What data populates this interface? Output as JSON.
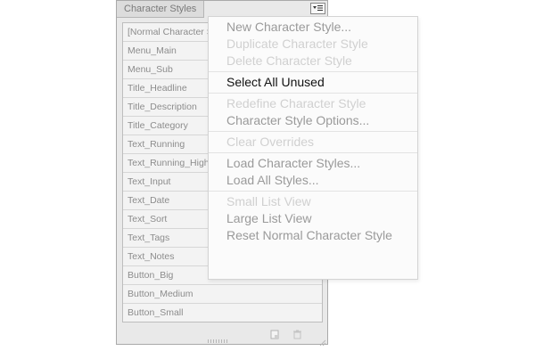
{
  "panel": {
    "title": "Character Styles",
    "menu_button_icon": "panel-menu-icon",
    "styles": [
      "[Normal Character Style]",
      "Menu_Main",
      "Menu_Sub",
      "Title_Headline",
      "Title_Description",
      "Title_Category",
      "Text_Running",
      "Text_Running_Highlight",
      "Text_Input",
      "Text_Date",
      "Text_Sort",
      "Text_Tags",
      "Text_Notes",
      "Button_Big",
      "Button_Medium",
      "Button_Small"
    ],
    "footer": {
      "new_style_icon": "new-style-icon",
      "delete_style_icon": "trash-icon"
    }
  },
  "flyout_menu": {
    "groups": [
      [
        {
          "label": "New Character Style...",
          "state": "enabled"
        },
        {
          "label": "Duplicate Character Style",
          "state": "disabled"
        },
        {
          "label": "Delete Character Style",
          "state": "disabled"
        }
      ],
      [
        {
          "label": "Select All Unused",
          "state": "highlighted"
        }
      ],
      [
        {
          "label": "Redefine Character Style",
          "state": "disabled"
        },
        {
          "label": "Character Style Options...",
          "state": "enabled"
        }
      ],
      [
        {
          "label": "Clear Overrides",
          "state": "disabled"
        }
      ],
      [
        {
          "label": "Load Character Styles...",
          "state": "enabled"
        },
        {
          "label": "Load All Styles...",
          "state": "enabled"
        }
      ],
      [
        {
          "label": "Small List View",
          "state": "disabled"
        },
        {
          "label": "Large List View",
          "state": "enabled"
        },
        {
          "label": "Reset Normal Character Style",
          "state": "enabled"
        }
      ]
    ]
  },
  "colors": {
    "panel_bg": "#e9e9e9",
    "menu_text_enabled": "#9a9a9a",
    "menu_text_disabled": "#d0d0d0",
    "menu_text_active": "#111111"
  }
}
